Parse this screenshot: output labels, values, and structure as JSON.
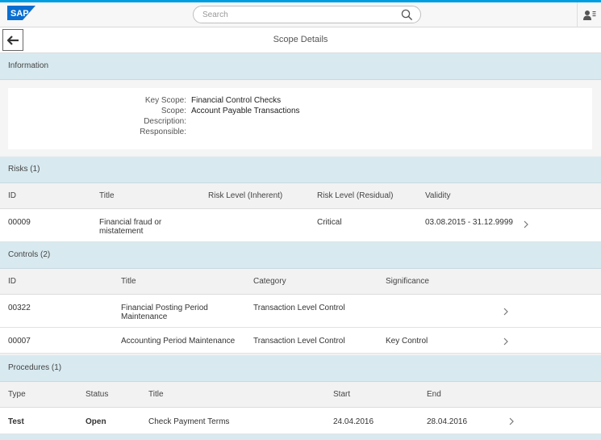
{
  "shell": {
    "logo": "SAP",
    "search_placeholder": "Search",
    "search_value": ""
  },
  "page": {
    "title": "Scope Details"
  },
  "information": {
    "header": "Information",
    "fields": [
      {
        "label": "Key Scope:",
        "value": "Financial Control Checks"
      },
      {
        "label": "Scope:",
        "value": "Account Payable Transactions"
      },
      {
        "label": "Description:",
        "value": ""
      },
      {
        "label": "Responsible:",
        "value": ""
      }
    ]
  },
  "risks": {
    "header": "Risks (1)",
    "columns": [
      "ID",
      "Title",
      "Risk Level (Inherent)",
      "Risk Level (Residual)",
      "Validity"
    ],
    "rows": [
      {
        "id": "00009",
        "title_line1": "Financial fraud or",
        "title_line2": "mistatement",
        "inherent": "",
        "residual": "Critical",
        "validity": "03.08.2015 - 31.12.9999"
      }
    ]
  },
  "controls": {
    "header": "Controls (2)",
    "columns": [
      "ID",
      "Title",
      "Category",
      "Significance"
    ],
    "rows": [
      {
        "id": "00322",
        "title_line1": "Financial Posting Period",
        "title_line2": "Maintenance",
        "category": "Transaction Level Control",
        "significance": ""
      },
      {
        "id": "00007",
        "title_line1": "Accounting Period Maintenance",
        "title_line2": "",
        "category": "Transaction Level Control",
        "significance": "Key Control"
      }
    ]
  },
  "procedures": {
    "header": "Procedures (1)",
    "columns": [
      "Type",
      "Status",
      "Title",
      "Start",
      "End"
    ],
    "rows": [
      {
        "type": "Test",
        "status": "Open",
        "title": "Check Payment Terms",
        "start": "24.04.2016",
        "end": "28.04.2016"
      }
    ]
  },
  "colors": {
    "accent": "#009de0",
    "section_header_bg": "#d8eaf0",
    "logo_blue": "#0a6ed1"
  },
  "icons": {
    "search": "search-icon",
    "user": "user-menu-icon",
    "back": "back-arrow-icon",
    "row_nav": "chevron-right-icon"
  }
}
